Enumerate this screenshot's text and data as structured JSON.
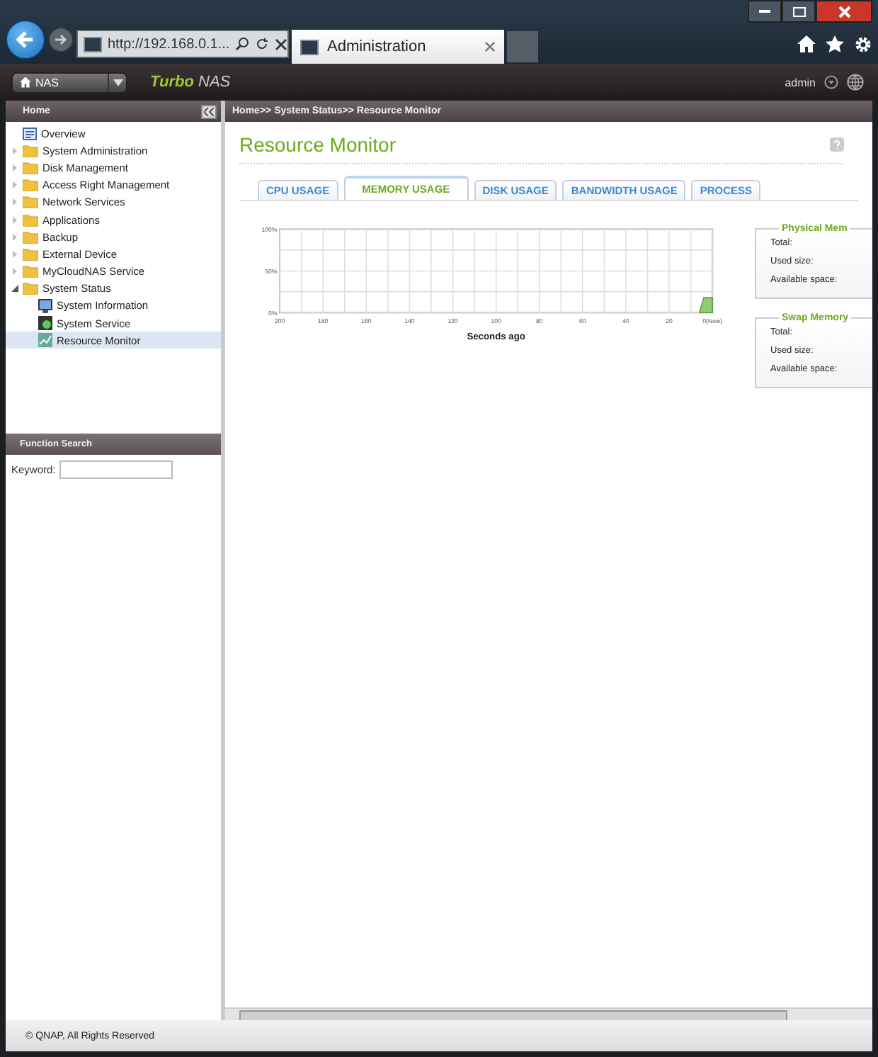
{
  "browser": {
    "address": "http://192.168.0.1...",
    "tab_title": "Administration"
  },
  "header": {
    "device": "NAS",
    "brand_first": "Turbo",
    "brand_second": "NAS",
    "user": "admin"
  },
  "sidebar": {
    "title": "Home",
    "tree": [
      {
        "label": "Overview",
        "kind": "page",
        "selected": false
      },
      {
        "label": "System Administration",
        "kind": "folder",
        "expanded": false,
        "selected": false
      },
      {
        "label": "Disk Management",
        "kind": "folder",
        "expanded": false,
        "selected": false
      },
      {
        "label": "Access Right Management",
        "kind": "folder",
        "expanded": false,
        "selected": false
      },
      {
        "label": "Network Services",
        "kind": "folder",
        "expanded": false,
        "selected": false
      },
      {
        "label": "Applications",
        "kind": "folder",
        "expanded": false,
        "selected": false
      },
      {
        "label": "Backup",
        "kind": "folder",
        "expanded": false,
        "selected": false
      },
      {
        "label": "External Device",
        "kind": "folder",
        "expanded": false,
        "selected": false
      },
      {
        "label": "MyCloudNAS Service",
        "kind": "folder",
        "expanded": false,
        "selected": false
      },
      {
        "label": "System Status",
        "kind": "folder",
        "expanded": true,
        "selected": false,
        "children": [
          {
            "label": "System Information",
            "kind": "info",
            "selected": false
          },
          {
            "label": "System Service",
            "kind": "service",
            "selected": false
          },
          {
            "label": "Resource Monitor",
            "kind": "monitor",
            "selected": true
          }
        ]
      }
    ]
  },
  "function_search": {
    "title": "Function Search",
    "keyword_label": "Keyword:"
  },
  "breadcrumb": "Home>> System Status>> Resource Monitor",
  "page_title": "Resource Monitor",
  "tabs": [
    {
      "label": "CPU USAGE",
      "selected": false
    },
    {
      "label": "MEMORY USAGE",
      "selected": true
    },
    {
      "label": "DISK USAGE",
      "selected": false
    },
    {
      "label": "BANDWIDTH USAGE",
      "selected": false
    },
    {
      "label": "PROCESS",
      "selected": false
    }
  ],
  "chart_data": {
    "type": "area",
    "xlabel": "Seconds ago",
    "x": [
      6,
      4,
      0
    ],
    "grid": true,
    "series": [
      {
        "color": "#8fcf7a",
        "values": [
          0,
          18,
          18
        ]
      }
    ],
    "xlim": [
      200,
      0
    ],
    "ylim": [
      0,
      100
    ],
    "xticks": [
      200,
      180,
      160,
      140,
      120,
      100,
      80,
      60,
      40,
      20,
      {
        "value": 0,
        "label": "0(Now)"
      }
    ],
    "yticks": [
      {
        "value": 0,
        "label": "0%"
      },
      {
        "value": 50,
        "label": "50%"
      },
      {
        "value": 100,
        "label": "100%"
      }
    ]
  },
  "panels": [
    {
      "title": "Physical Mem",
      "rows": [
        "Total:",
        "Used size:",
        "Available space:"
      ]
    },
    {
      "title": "Swap Memory",
      "rows": [
        "Total:",
        "Used size:",
        "Available space:"
      ]
    }
  ],
  "footer": "© QNAP, All Rights Reserved"
}
